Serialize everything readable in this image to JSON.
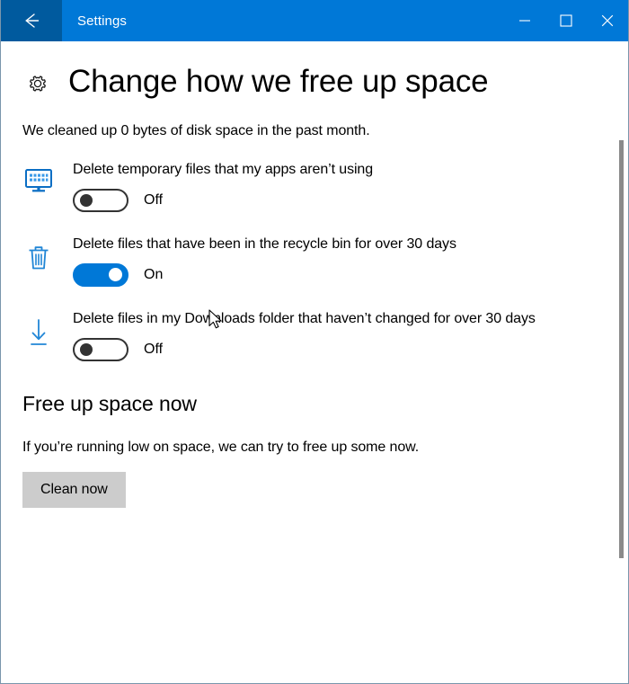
{
  "window": {
    "title": "Settings",
    "back_icon": "back-arrow-icon",
    "controls": {
      "minimize": "minimize-icon",
      "maximize": "maximize-icon",
      "close": "close-icon"
    },
    "accent_color": "#0078d7",
    "back_button_color": "#005a9e",
    "border_color": "#7a96ac"
  },
  "page": {
    "icon": "gear-icon",
    "title": "Change how we free up space",
    "summary": "We cleaned up 0 bytes of disk space in the past month."
  },
  "settings": [
    {
      "icon": "monitor-temp-files-icon",
      "label": "Delete temporary files that my apps aren’t using",
      "toggle_state": "Off",
      "toggle_on": false
    },
    {
      "icon": "recycle-bin-icon",
      "label": "Delete files that have been in the recycle bin for over 30 days",
      "toggle_state": "On",
      "toggle_on": true
    },
    {
      "icon": "download-arrow-icon",
      "label": "Delete files in my Downloads folder that haven’t changed for over 30 days",
      "toggle_state": "Off",
      "toggle_on": false
    }
  ],
  "free_up_section": {
    "heading": "Free up space now",
    "description": "If you’re running low on space, we can try to free up some now.",
    "button_label": "Clean now",
    "button_color": "#cccccc"
  },
  "scrollbar": {
    "thumb_color": "#8a8a8a"
  }
}
